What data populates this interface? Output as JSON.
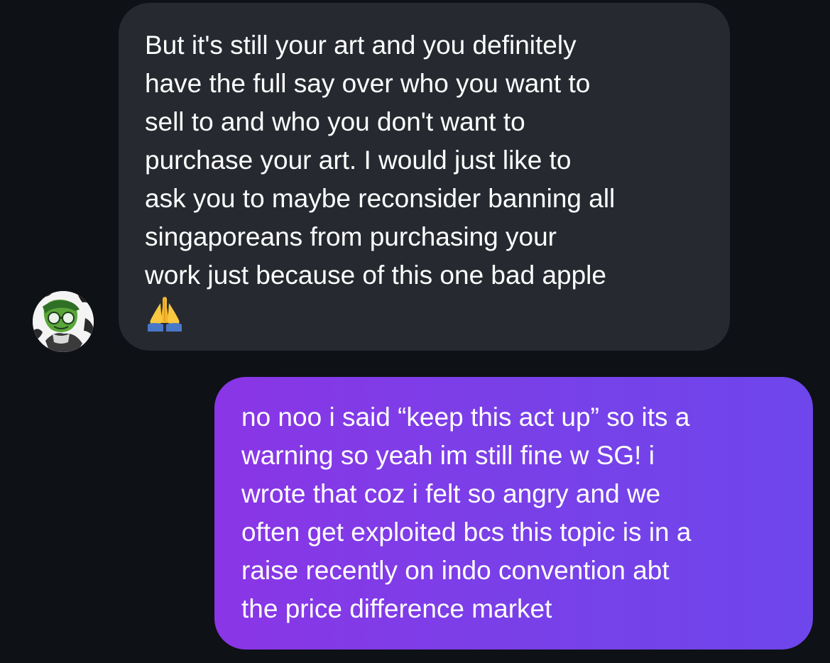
{
  "conversation": {
    "incoming": {
      "lines": [
        "But it's still your art and you definitely",
        "have the full say over who you want to",
        "sell to and who you don't want to",
        "purchase your art. I would just like to",
        "ask you to maybe reconsider banning all",
        "singaporeans from purchasing your",
        "work just because of this one bad apple"
      ],
      "emoji": "folded-hands-icon"
    },
    "outgoing": {
      "lines": [
        "no noo i said “keep this act up” so its a",
        "warning so yeah im still fine w SG! i",
        "wrote that coz i felt so angry and we",
        "often get exploited bcs this topic is in a",
        "raise recently on indo convention abt",
        "the price difference market"
      ]
    }
  },
  "colors": {
    "background": "#0e1115",
    "incoming_bubble": "#262a30",
    "outgoing_bubble_start": "#8a35e6",
    "outgoing_bubble_end": "#6e46ec",
    "text": "#ffffff"
  }
}
